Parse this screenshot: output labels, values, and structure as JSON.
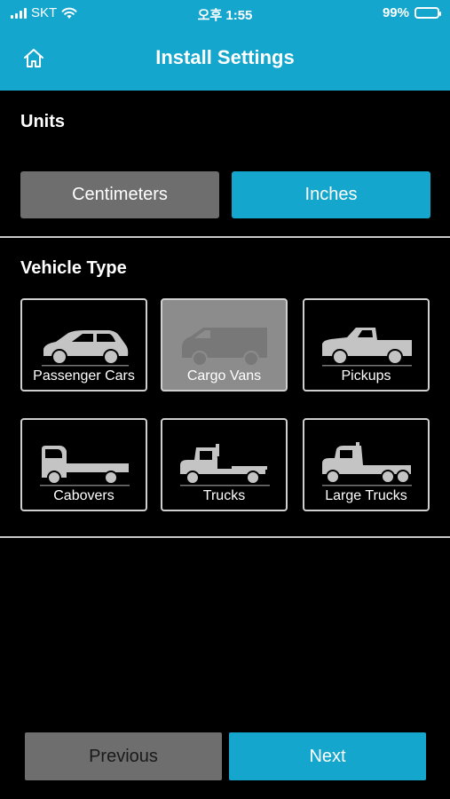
{
  "status_bar": {
    "carrier": "SKT",
    "time": "오후 1:55",
    "battery": "99%"
  },
  "header": {
    "title": "Install Settings",
    "home_icon": "home-icon"
  },
  "units": {
    "title": "Units",
    "options": [
      {
        "label": "Centimeters",
        "selected": false
      },
      {
        "label": "Inches",
        "selected": true
      }
    ]
  },
  "vehicle_type": {
    "title": "Vehicle Type",
    "items": [
      {
        "label": "Passenger Cars",
        "icon": "car-icon",
        "selected": false
      },
      {
        "label": "Cargo Vans",
        "icon": "van-icon",
        "selected": true
      },
      {
        "label": "Pickups",
        "icon": "pickup-icon",
        "selected": false
      },
      {
        "label": "Cabovers",
        "icon": "cabover-icon",
        "selected": false
      },
      {
        "label": "Trucks",
        "icon": "truck-icon",
        "selected": false
      },
      {
        "label": "Large Trucks",
        "icon": "large-truck-icon",
        "selected": false
      }
    ]
  },
  "footer": {
    "previous_label": "Previous",
    "next_label": "Next"
  },
  "colors": {
    "accent": "#14a6cc",
    "button_inactive": "#6e6e6e",
    "card_selected": "#8c8c8c",
    "vehicle_icon": "#c4c4c4"
  }
}
